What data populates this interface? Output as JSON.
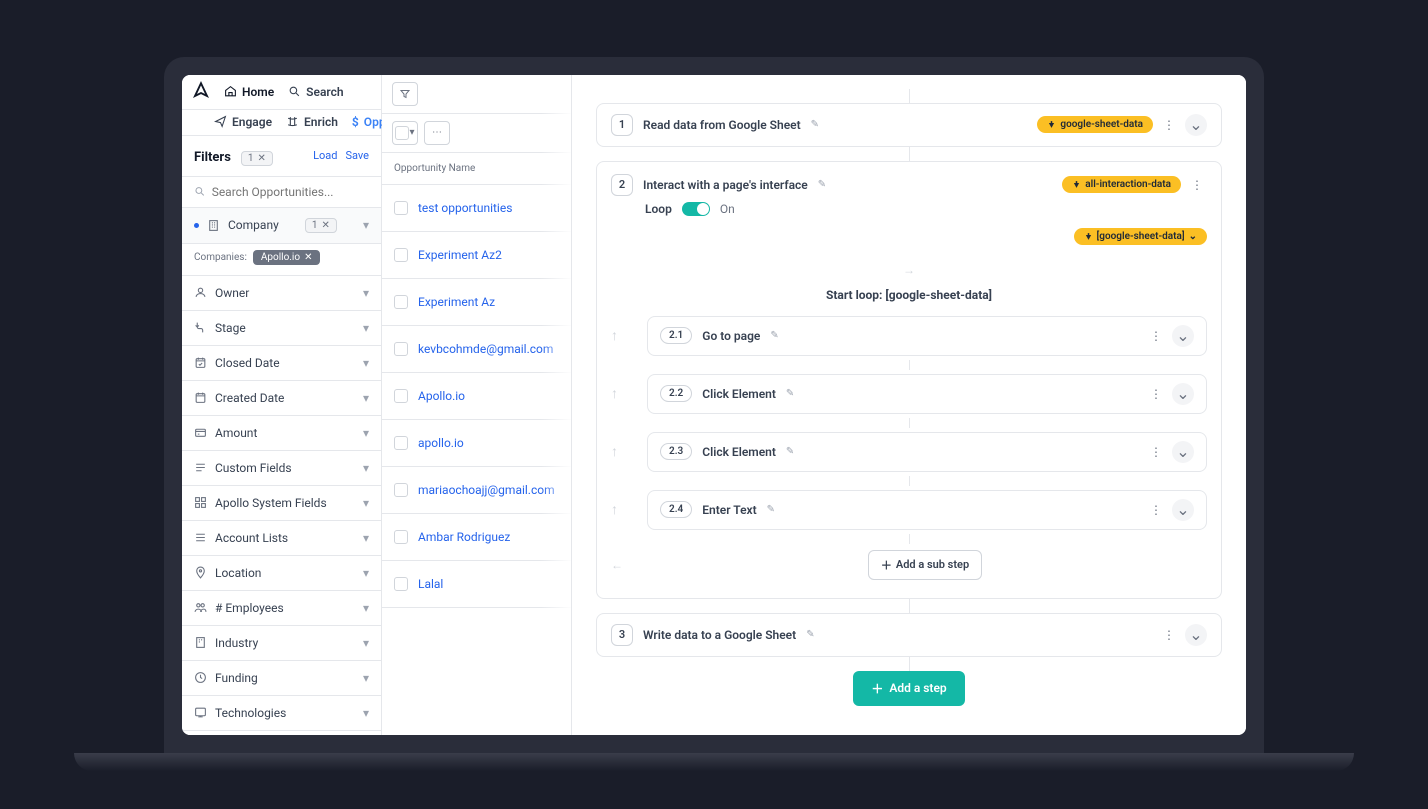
{
  "nav": {
    "tabs": [
      "Home",
      "Search",
      "Engage",
      "Enrich",
      "Oppo"
    ]
  },
  "filters": {
    "title": "Filters",
    "count": "1",
    "load": "Load",
    "save": "Save",
    "search_placeholder": "Search Opportunities...",
    "company": "Company",
    "company_count": "1",
    "companies_label": "Companies:",
    "company_chip": "Apollo.io",
    "items": [
      "Owner",
      "Stage",
      "Closed Date",
      "Created Date",
      "Amount",
      "Custom Fields",
      "Apollo System Fields",
      "Account Lists",
      "Location",
      "# Employees",
      "Industry",
      "Funding",
      "Technologies"
    ]
  },
  "opportunities": {
    "header": "Opportunity Name",
    "rows": [
      "test opportunities",
      "Experiment Az2",
      "Experiment Az",
      "kevbcohmde@gmail.com",
      "Apollo.io",
      "apollo.io",
      "mariaochoajj@gmail.com",
      "Ambar Rodriguez",
      "Lalal"
    ]
  },
  "workflow": {
    "step1": {
      "num": "1",
      "label": "Read data from Google Sheet",
      "tag": "google-sheet-data"
    },
    "step2": {
      "num": "2",
      "label": "Interact with a page's interface",
      "tag": "all-interaction-data",
      "loop_label": "Loop",
      "loop_state": "On",
      "loop_data": "[google-sheet-data]",
      "loop_title": "Start loop: [google-sheet-data]"
    },
    "substeps": [
      {
        "num": "2.1",
        "label": "Go to page"
      },
      {
        "num": "2.2",
        "label": "Click Element"
      },
      {
        "num": "2.3",
        "label": "Click Element"
      },
      {
        "num": "2.4",
        "label": "Enter Text"
      }
    ],
    "add_sub": "Add a sub step",
    "step3": {
      "num": "3",
      "label": "Write data to a Google Sheet"
    },
    "add_step": "Add a step"
  }
}
